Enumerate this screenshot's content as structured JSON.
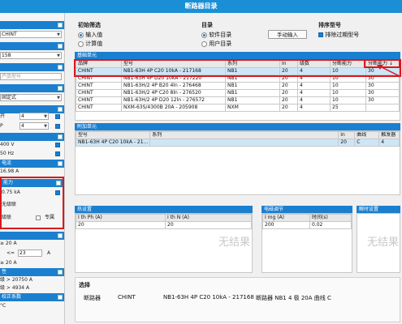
{
  "app": {
    "title": "断路器目录"
  },
  "left_panel": {
    "brand_value": "CHINT",
    "size_value": "158",
    "model_placeholder": "产品型号",
    "install_value": "固定式",
    "lbl_open": "开",
    "open_value": "4",
    "lbl_p": "P",
    "p_value": "4",
    "voltage_value": "400 V",
    "freq_value": "50 Hz",
    "current_head": "电流",
    "current_value": "16.98 A",
    "breaking_head": "能力",
    "breaking_value": "0.75 kA",
    "no_release": "无级联",
    "cascade": "级联",
    "fixed": "专属",
    "rating_line": "≥ 20 A",
    "le_label": "<=",
    "le_value": "23",
    "le_unit": "A",
    "rating2": "≥ 20 A",
    "prop_head": "性",
    "prop_val1": "级 > 20750 A",
    "prop_val2": "级 > 4934 A",
    "corr_head": "校正系数",
    "temp_value": "°C"
  },
  "filters": {
    "init_label": "初始筛选",
    "opt_input": "输入值",
    "opt_calc": "计算值",
    "catalog_label": "目录",
    "opt_software": "软件目录",
    "opt_user": "用户目录",
    "manual_input": "手动输入",
    "sort_label": "排序型号",
    "exclude_expired": "排除过期型号"
  },
  "base_unit": {
    "header": "基础单元",
    "columns": [
      "品牌",
      "型号",
      "系列",
      "In",
      "级数",
      "分断能力",
      "分断能力 ↓"
    ],
    "rows": [
      [
        "CHINT",
        "NB1-63H 4P C20 10kA - 217168",
        "NB1",
        "20",
        "4",
        "10",
        "30"
      ],
      [
        "CHINT",
        "NB1-63H 4P D20 10kA - 217220",
        "NB1",
        "20",
        "4",
        "10",
        "30"
      ],
      [
        "CHINT",
        "NB1-63H/2 4P B20 4ln - 276468",
        "NB1",
        "20",
        "4",
        "10",
        "30"
      ],
      [
        "CHINT",
        "NB1-63H/2 4P C20 8ln - 276520",
        "NB1",
        "20",
        "4",
        "10",
        "30"
      ],
      [
        "CHINT",
        "NB1-63H/2 4P D20 12ln - 276572",
        "NB1",
        "20",
        "4",
        "10",
        "30"
      ],
      [
        "CHINT",
        "NXM-63S/4300B 20A - 205908",
        "NXM",
        "20",
        "4",
        "25",
        ""
      ]
    ]
  },
  "addon_unit": {
    "header": "附加单元",
    "columns": [
      "型号",
      "系列",
      "In",
      "曲线",
      "触发器"
    ],
    "row": [
      "NB1-63H 4P C20 10kA - 21...",
      "",
      "20",
      "C",
      "4"
    ]
  },
  "thermal": {
    "header": "热设置",
    "col1": "I th Ph (A)",
    "col2": "I th N (A)",
    "v1": "20",
    "v2": "20"
  },
  "mag": {
    "header": "电磁调节",
    "col1": "I mg (A)",
    "col2": "时间(s)",
    "v1": "200",
    "v2": "0.02"
  },
  "instant": {
    "header": "瞬时设置"
  },
  "no_result": "无结果",
  "selection": {
    "header": "选择",
    "type": "断路器",
    "brand": "CHINT",
    "model": "NB1-63H 4P C20 10kA - 217168",
    "desc": "断路器 NB1 4 极 20A 曲线 C"
  },
  "colors": {
    "accent": "#1b7fd0",
    "highlight": "#d9181f",
    "title": "#1b8fd6"
  }
}
